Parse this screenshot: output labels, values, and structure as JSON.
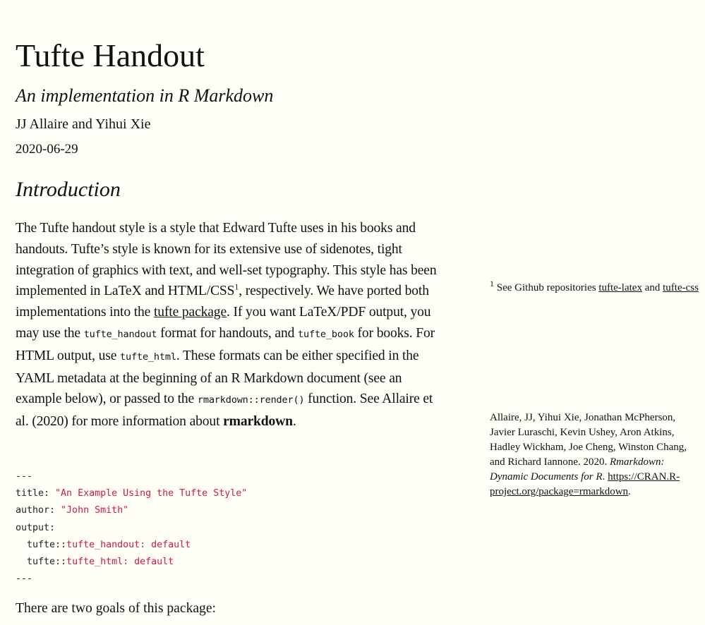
{
  "title": "Tufte Handout",
  "subtitle": "An implementation in R Markdown",
  "author": "JJ Allaire and Yihui Xie",
  "date": "2020-06-29",
  "section": "Introduction",
  "intro": {
    "s0": "The Tufte handout style is a style that Edward Tufte uses in his books and handouts. Tufte’s style is known for its extensive use of sidenotes, tight integration of graphics with text, and well-set typography. This style has been implemented in LaTeX and HTML/CSS",
    "fnref": "1",
    "s1": ", respectively. We have ported both implementations into the ",
    "link_tufte": "tufte package",
    "s2": ". If you want LaTeX/PDF output, you may use the ",
    "code1": "tufte_handout",
    "s3": " format for handouts, and ",
    "code2": "tufte_book",
    "s4": " for books. For HTML output, use ",
    "code3": "tufte_html",
    "s5": ". These formats can be either specified in the YAML metadata at the beginning of an R Markdown document (see an example below), or passed to the ",
    "code4": "rmarkdown::render()",
    "s6": " function. See Allaire et al. (2020) for more information about ",
    "bold": "rmarkdown",
    "s7": "."
  },
  "yaml": {
    "l1": "---",
    "k2": "title: ",
    "v2": "\"An Example Using the Tufte Style\"",
    "k3": "author: ",
    "v3": "\"John Smith\"",
    "k4": "output:",
    "k5": "  tufte::",
    "v5": "tufte_handout: default",
    "k6": "  tufte::",
    "v6": "tufte_html: default",
    "l7": "---"
  },
  "goals": "There are two goals of this package:",
  "sidenote": {
    "num": "1",
    "text": " See Github repositories ",
    "link1": "tufte-latex",
    "and": " and ",
    "link2": "tufte-css"
  },
  "reference": {
    "authors": "Allaire, JJ, Yihui Xie, Jonathan McPherson, Javier Luraschi, Kevin Ushey, Aron Atkins, Hadley Wickham, Joe Cheng, Winston Chang, and Richard Iannone. 2020. ",
    "title": "Rmarkdown: Dynamic Documents for R",
    "sep": ". ",
    "url": "https://CRAN.R-project.org/package=rmarkdown",
    "end": "."
  }
}
